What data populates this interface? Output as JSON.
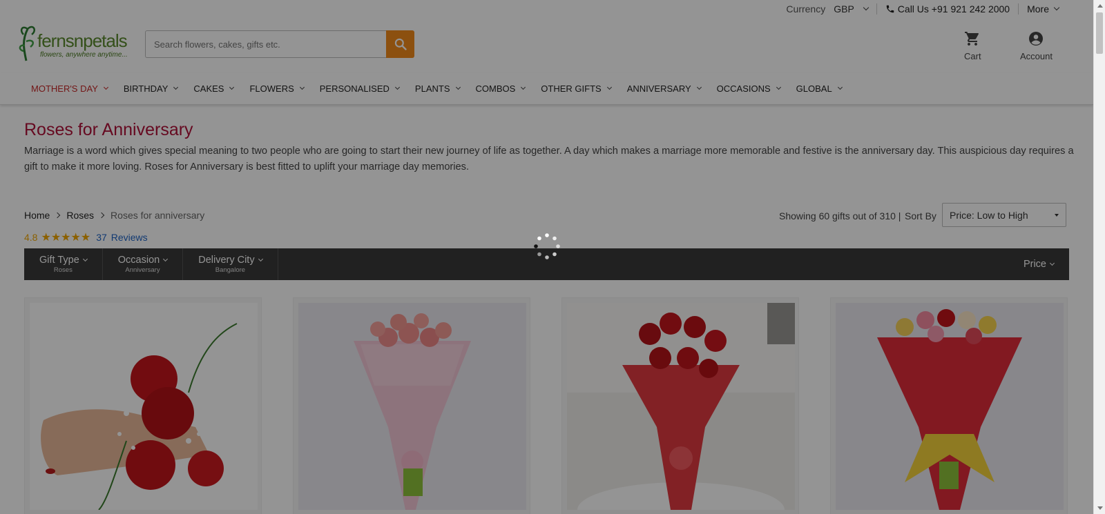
{
  "topbar": {
    "currency_label": "Currency",
    "currency_value": "GBP",
    "call_label": "Call Us +91 921 242 2000",
    "more_label": "More"
  },
  "header": {
    "brand": "fernsnpetals",
    "tagline": "flowers, anywhere anytime...",
    "search_placeholder": "Search flowers, cakes, gifts etc.",
    "cart_label": "Cart",
    "account_label": "Account"
  },
  "nav": {
    "items": [
      "MOTHER'S DAY",
      "BIRTHDAY",
      "CAKES",
      "FLOWERS",
      "PERSONALISED",
      "PLANTS",
      "COMBOS",
      "OTHER GIFTS",
      "ANNIVERSARY",
      "OCCASIONS",
      "GLOBAL"
    ],
    "active_color": "#c62828"
  },
  "page": {
    "title": "Roses for Anniversary",
    "description": "Marriage is a word which gives special meaning to two people who are going to start their new journey of life as together. A day which makes a marriage more memorable and festive is the anniversary day. This auspicious day requires a gift to make it more loving. Roses for Anniversary is best fitted to uplift your marriage day memories."
  },
  "breadcrumb": {
    "home": "Home",
    "roses": "Roses",
    "current": "Roses for anniversary"
  },
  "rating": {
    "score": "4.8",
    "stars": "★★★★★",
    "review_count": "37",
    "review_label": "Reviews"
  },
  "listing": {
    "showing": "Showing 60 gifts out of 310 |",
    "sort_label": "Sort By",
    "sort_value": "Price: Low to High"
  },
  "filters": [
    {
      "name": "Gift Type",
      "value": "Roses"
    },
    {
      "name": "Occasion",
      "value": "Anniversary"
    },
    {
      "name": "Delivery City",
      "value": "Bangalore"
    }
  ],
  "price_filter": "Price",
  "colors": {
    "accent_orange": "#f18a1a",
    "title_red": "#b0123a",
    "filter_bar": "#3a3a3a",
    "star": "#f0a500"
  }
}
